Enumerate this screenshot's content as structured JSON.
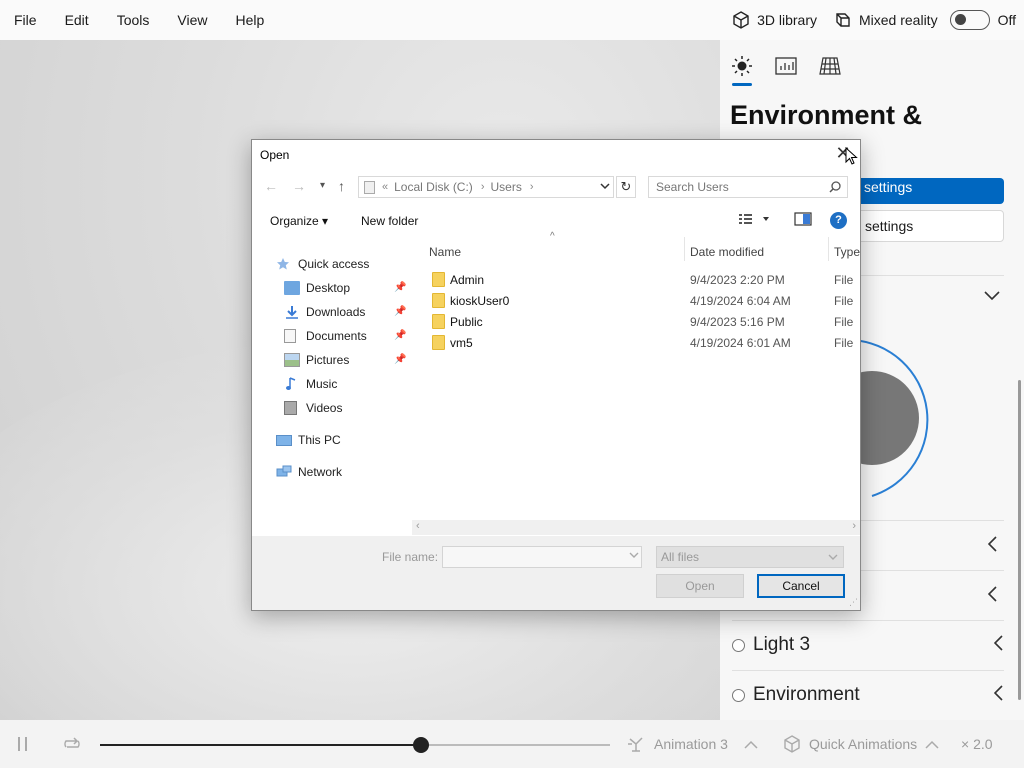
{
  "menubar": {
    "items": [
      "File",
      "Edit",
      "Tools",
      "View",
      "Help"
    ],
    "library_label": "3D library",
    "mixed_reality_label": "Mixed reality",
    "toggle_state": "Off"
  },
  "right_panel": {
    "title": "Environment &",
    "primary_button": "settings",
    "secondary_button": "settings",
    "lights": [
      "Light 3",
      "Environment"
    ]
  },
  "bottombar": {
    "animation_label": "Animation 3",
    "quick_animations_label": "Quick Animations",
    "speed_label": "× 2.0",
    "timeline_progress": 0.63
  },
  "dialog": {
    "title": "Open",
    "address": {
      "drive": "Local Disk (C:)",
      "folder": "Users"
    },
    "search_placeholder": "Search Users",
    "toolbar": {
      "organize": "Organize",
      "new_folder": "New folder"
    },
    "nav": {
      "quick_access": "Quick access",
      "desktop": "Desktop",
      "downloads": "Downloads",
      "documents": "Documents",
      "pictures": "Pictures",
      "music": "Music",
      "videos": "Videos",
      "this_pc": "This PC",
      "network": "Network"
    },
    "columns": {
      "name": "Name",
      "date": "Date modified",
      "type": "Type"
    },
    "files": [
      {
        "name": "Admin",
        "date": "9/4/2023 2:20 PM",
        "type": "File fo"
      },
      {
        "name": "kioskUser0",
        "date": "4/19/2024 6:04 AM",
        "type": "File fo"
      },
      {
        "name": "Public",
        "date": "9/4/2023 5:16 PM",
        "type": "File fo"
      },
      {
        "name": "vm5",
        "date": "4/19/2024 6:01 AM",
        "type": "File fo"
      }
    ],
    "file_name_label": "File name:",
    "filter_label": "All files",
    "open_button": "Open",
    "cancel_button": "Cancel"
  }
}
